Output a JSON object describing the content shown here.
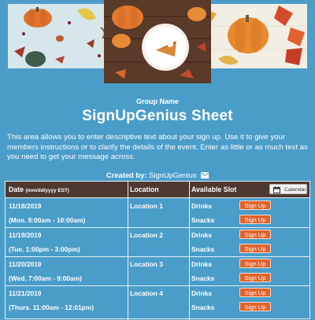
{
  "header": {
    "group_name": "Group Name",
    "title": "SignUpGenius Sheet",
    "description": "This area allows you to enter descriptive text about your sign up. Use it to give your members instructions or to clarify the details of the event. Enter as little or as much text as you need to get your message across.",
    "created_by_label": "Created by:",
    "created_by_name": "SignUpGenius"
  },
  "table": {
    "columns": {
      "date": "Date",
      "date_format": "(mm/dd/yyyy EST)",
      "location": "Location",
      "slot": "Available Slot"
    },
    "calendar_button": "Calendar",
    "signup_label": "Sign Up",
    "rows": [
      {
        "date": "11/18/2019",
        "time": "(Mon. 9:00am - 10:00am)",
        "location": "Location 1",
        "slots": [
          "Drinks",
          "Snacks"
        ]
      },
      {
        "date": "11/19/2019",
        "time": "(Tue. 1:00pm - 3:00pm)",
        "location": "Location 2",
        "slots": [
          "Drinks",
          "Snacks"
        ]
      },
      {
        "date": "11/20/2019",
        "time": "(Wed. 7:00am - 9:00am)",
        "location": "Location 3",
        "slots": [
          "Drinks",
          "Snacks"
        ]
      },
      {
        "date": "11/21/2019",
        "time": "(Thurs. 11:00am - 12:01pm)",
        "location": "Location 4",
        "slots": [
          "Drinks",
          "Snacks"
        ]
      }
    ]
  },
  "colors": {
    "background": "#4a9dc9",
    "table_header": "#4e3830",
    "signup_button": "#e2622a"
  },
  "icons": {
    "created_by": "envelope-icon",
    "calendar": "calendar-icon"
  }
}
